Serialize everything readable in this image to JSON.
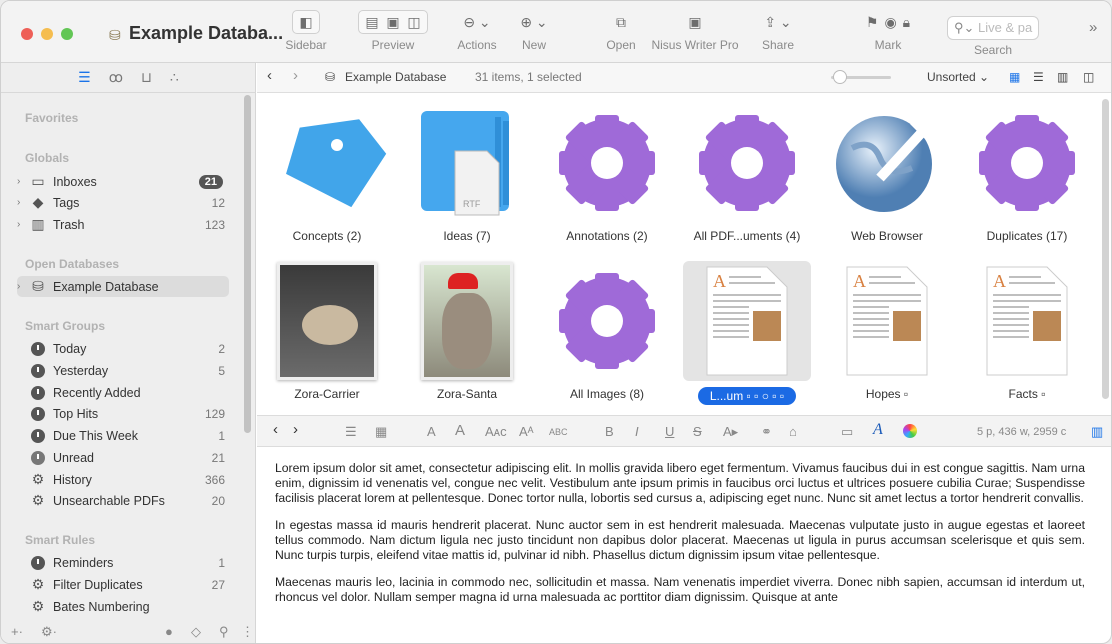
{
  "window": {
    "title": "Example Databa...",
    "colors": {
      "close": "#ee5f57",
      "minimize": "#f5bd4f",
      "zoom": "#62c655",
      "accent": "#1b6ae4",
      "gear": "#9f6ad8",
      "tag": "#41a5ea"
    }
  },
  "toolbar": {
    "sidebar": "Sidebar",
    "preview": "Preview",
    "actions": "Actions",
    "new": "New",
    "open": "Open",
    "nisus": "Nisus Writer Pro",
    "share": "Share",
    "mark": "Mark",
    "search": "Search",
    "search_placeholder": "Live & pa"
  },
  "sidebar": {
    "sections": {
      "favorites": "Favorites",
      "globals": "Globals",
      "open_databases": "Open Databases",
      "smart_groups": "Smart Groups",
      "smart_rules": "Smart Rules"
    },
    "globals": [
      {
        "label": "Inboxes",
        "count": "21",
        "icon": "inbox-icon"
      },
      {
        "label": "Tags",
        "count": "12",
        "icon": "tag-icon"
      },
      {
        "label": "Trash",
        "count": "123",
        "icon": "trash-icon"
      }
    ],
    "databases": [
      {
        "label": "Example Database",
        "icon": "database-icon"
      }
    ],
    "smart_groups": [
      {
        "label": "Today",
        "count": "2"
      },
      {
        "label": "Yesterday",
        "count": "5"
      },
      {
        "label": "Recently Added",
        "count": ""
      },
      {
        "label": "Top Hits",
        "count": "129"
      },
      {
        "label": "Due This Week",
        "count": "1"
      },
      {
        "label": "Unread",
        "count": "21"
      },
      {
        "label": "History",
        "count": "366"
      },
      {
        "label": "Unsearchable PDFs",
        "count": "20"
      }
    ],
    "smart_rules": [
      {
        "label": "Reminders",
        "count": "1"
      },
      {
        "label": "Filter Duplicates",
        "count": "27"
      },
      {
        "label": "Bates Numbering",
        "count": ""
      }
    ]
  },
  "pathbar": {
    "database": "Example Database",
    "status": "31 items, 1 selected",
    "sort": "Unsorted"
  },
  "items": [
    {
      "caption": "Concepts (2)",
      "kind": "tags"
    },
    {
      "caption": "Ideas (7)",
      "kind": "rtf-group"
    },
    {
      "caption": "Annotations (2)",
      "kind": "gear"
    },
    {
      "caption": "All PDF...uments (4)",
      "kind": "gear"
    },
    {
      "caption": "Web Browser",
      "kind": "globe"
    },
    {
      "caption": "Duplicates (17)",
      "kind": "gear"
    },
    {
      "caption": "Zora-Carrier",
      "kind": "photo"
    },
    {
      "caption": "Zora-Santa",
      "kind": "photo"
    },
    {
      "caption": "All Images (8)",
      "kind": "gear"
    },
    {
      "caption": "L...um",
      "kind": "document",
      "selected": true
    },
    {
      "caption": "Hopes",
      "kind": "document"
    },
    {
      "caption": "Facts",
      "kind": "document"
    }
  ],
  "rtf_label": "RTF",
  "editor": {
    "stats": "5 p, 436 w, 2959 c",
    "paragraphs": [
      "Lorem ipsum dolor sit amet, consectetur adipiscing elit. In mollis gravida libero eget fermentum. Vivamus faucibus dui in est congue sagittis. Nam urna enim, dignissim id venenatis vel, congue nec velit. Vestibulum ante ipsum primis in faucibus orci luctus et ultrices posuere cubilia Curae; Suspendisse facilisis placerat lorem at pellentesque. Donec tortor nulla, lobortis sed cursus a, adipiscing eget nunc. Nunc sit amet lectus a tortor hendrerit convallis.",
      "In egestas massa id mauris hendrerit placerat. Nunc auctor sem in est hendrerit malesuada. Maecenas vulputate justo in augue egestas et laoreet tellus commodo. Nam dictum ligula nec justo tincidunt non dapibus dolor placerat. Maecenas ut ligula in purus accumsan scelerisque et quis sem. Nunc turpis turpis, eleifend vitae mattis id, pulvinar id nibh. Phasellus dictum dignissim ipsum vitae pellentesque.",
      "Maecenas mauris leo, lacinia in commodo nec, sollicitudin et massa. Nam venenatis imperdiet viverra. Donec nibh sapien, accumsan id interdum ut, rhoncus vel dolor. Nullam semper magna id urna malesuada ac porttitor diam dignissim. Quisque at ante"
    ]
  }
}
